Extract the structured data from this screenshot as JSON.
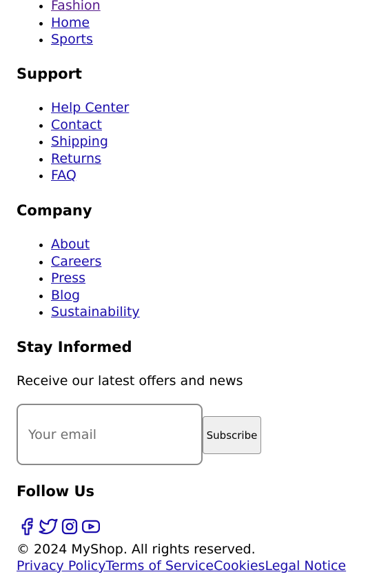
{
  "categories": {
    "items": [
      {
        "label": "Fashion",
        "visited": true
      },
      {
        "label": "Home"
      },
      {
        "label": "Sports"
      }
    ]
  },
  "support": {
    "heading": "Support",
    "items": [
      {
        "label": "Help Center"
      },
      {
        "label": "Contact"
      },
      {
        "label": "Shipping"
      },
      {
        "label": "Returns"
      },
      {
        "label": "FAQ"
      }
    ]
  },
  "company": {
    "heading": "Company",
    "items": [
      {
        "label": "About"
      },
      {
        "label": "Careers"
      },
      {
        "label": "Press"
      },
      {
        "label": "Blog"
      },
      {
        "label": "Sustainability"
      }
    ]
  },
  "newsletter": {
    "heading": "Stay Informed",
    "text": "Receive our latest offers and news",
    "placeholder": "Your email",
    "button_label": "Subscribe"
  },
  "social": {
    "heading": "Follow Us",
    "icons": [
      "facebook-icon",
      "twitter-icon",
      "instagram-icon",
      "youtube-icon"
    ],
    "icon_color": "#1a0dab"
  },
  "footer": {
    "copyright": "© 2024 MyShop. All rights reserved.",
    "legal_links": [
      "Privacy Policy",
      "Terms of Service",
      "Cookies",
      "Legal Notice"
    ]
  },
  "colors": {
    "link": "#1a0dab",
    "visited_link": "#551a8b",
    "text": "#000000"
  }
}
